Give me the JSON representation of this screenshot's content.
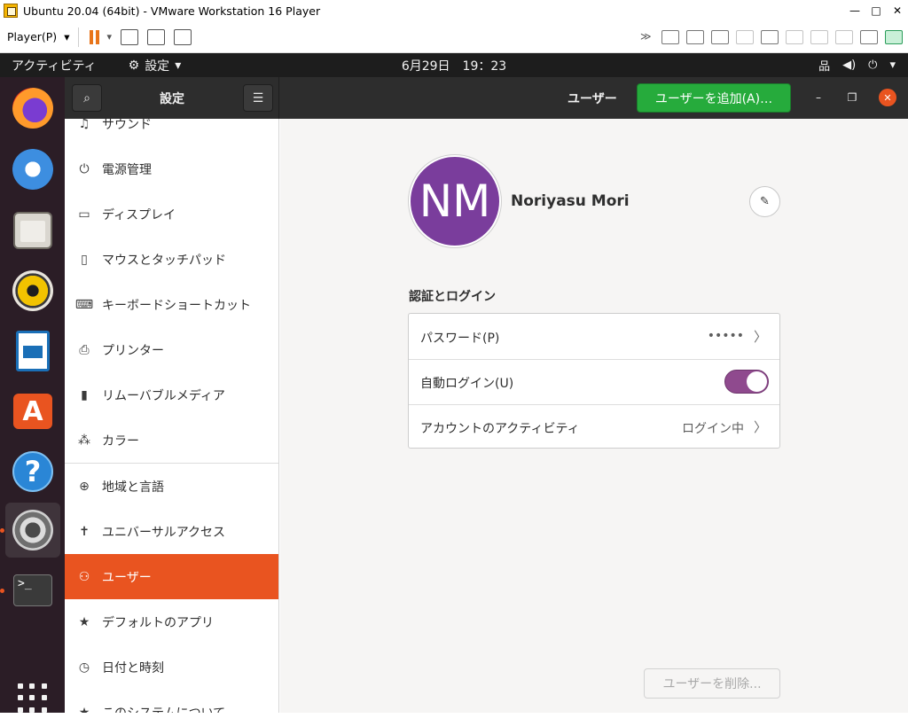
{
  "vmware": {
    "window_title": "Ubuntu 20.04 (64bit) - VMware Workstation 16 Player",
    "player_menu": "Player(P)"
  },
  "gnome": {
    "activities": "アクティビティ",
    "app_menu": "設定",
    "clock": "6月29日　19：23"
  },
  "settings": {
    "sidebar_title": "設定",
    "page_title": "ユーザー",
    "add_user_label": "ユーザーを追加(A)…",
    "sidebar_items": [
      {
        "label": "サウンド",
        "icon": "music-note-icon"
      },
      {
        "label": "電源管理",
        "icon": "power-icon"
      },
      {
        "label": "ディスプレイ",
        "icon": "display-icon"
      },
      {
        "label": "マウスとタッチパッド",
        "icon": "mouse-icon"
      },
      {
        "label": "キーボードショートカット",
        "icon": "keyboard-icon"
      },
      {
        "label": "プリンター",
        "icon": "printer-icon"
      },
      {
        "label": "リムーバブルメディア",
        "icon": "usb-drive-icon"
      },
      {
        "label": "カラー",
        "icon": "color-icon"
      },
      {
        "label": "地域と言語",
        "icon": "globe-icon"
      },
      {
        "label": "ユニバーサルアクセス",
        "icon": "accessibility-icon"
      },
      {
        "label": "ユーザー",
        "icon": "users-icon"
      },
      {
        "label": "デフォルトのアプリ",
        "icon": "star-icon"
      },
      {
        "label": "日付と時刻",
        "icon": "clock-icon"
      },
      {
        "label": "このシステムについて",
        "icon": "star-icon"
      }
    ],
    "user": {
      "initials": "NM",
      "name": "Noriyasu Mori"
    },
    "auth_section_title": "認証とログイン",
    "auth_rows": [
      {
        "label": "パスワード(P)",
        "value": "•••••"
      },
      {
        "label": "自動ログイン(U)",
        "toggle_on": true
      },
      {
        "label": "アカウントのアクティビティ",
        "value": "ログイン中"
      }
    ],
    "delete_user_label": "ユーザーを削除..."
  },
  "colors": {
    "ubuntu_orange": "#e95420",
    "add_button_green": "#26ab3c",
    "avatar_purple": "#7a3d9c",
    "toggle_purple": "#8f4a8e"
  }
}
